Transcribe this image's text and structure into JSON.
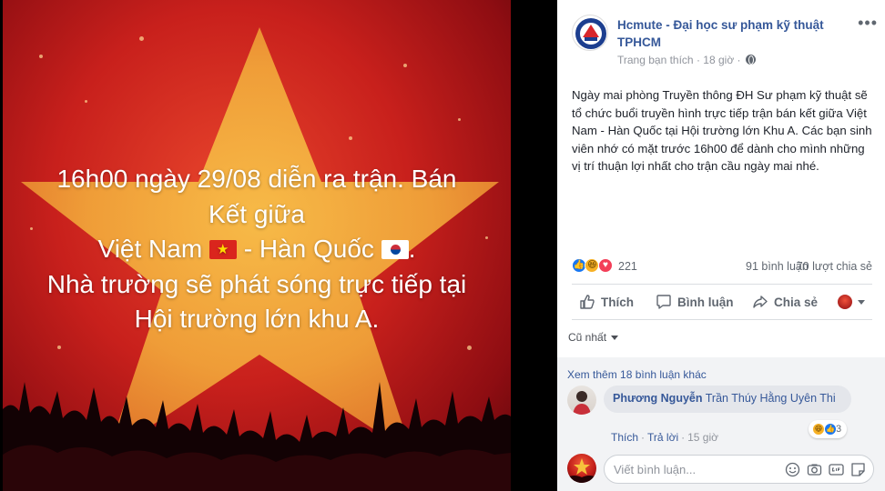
{
  "photo": {
    "caption_line1": "16h00 ngày 29/08 diễn ra trận. Bán",
    "caption_line2": "Kết giữa",
    "caption_line3a": "Việt Nam",
    "caption_line3b": "- Hàn Quốc",
    "caption_line3c": ".",
    "caption_line4": "Nhà trường sẽ phát sóng trực tiếp tại",
    "caption_line5": "Hội trường lớn khu A."
  },
  "post": {
    "page_name": "Hcmute - Đại học sư phạm kỹ thuật TPHCM",
    "more": "•••",
    "meta_source": "Trang bạn thích",
    "meta_sep": "·",
    "meta_time": "18 giờ",
    "text": "Ngày mai phòng Truyền thông ĐH Sư phạm kỹ thuật sẽ tổ chức buổi truyền hình trực tiếp trận bán kết giữa Việt Nam - Hàn Quốc tại Hội trường lớn Khu A. Các bạn sinh viên nhớ có mặt trước 16h00 để dành cho mình những vị trí thuận lợi nhất cho trận cầu ngày mai nhé.",
    "reaction_count": "221",
    "comment_count": "91 bình luận",
    "share_count": "70 lượt chia sẻ"
  },
  "actions": {
    "like": "Thích",
    "comment": "Bình luận",
    "share": "Chia sẻ"
  },
  "sort": {
    "label": "Cũ nhất"
  },
  "comments": {
    "view_more": "Xem thêm 18 bình luận khác",
    "items": [
      {
        "author": "Phương Nguyễn",
        "tag": "Trần Thúy Hằng Uyên Thi",
        "reaction_count": "3",
        "like": "Thích",
        "reply": "Trả lời",
        "time": "15 giờ"
      }
    ],
    "composer_placeholder": "Viết bình luận..."
  },
  "colors": {
    "link": "#365899",
    "like_blue": "#1877f2",
    "love_red": "#f33e58",
    "haha_yellow": "#f7b125"
  }
}
